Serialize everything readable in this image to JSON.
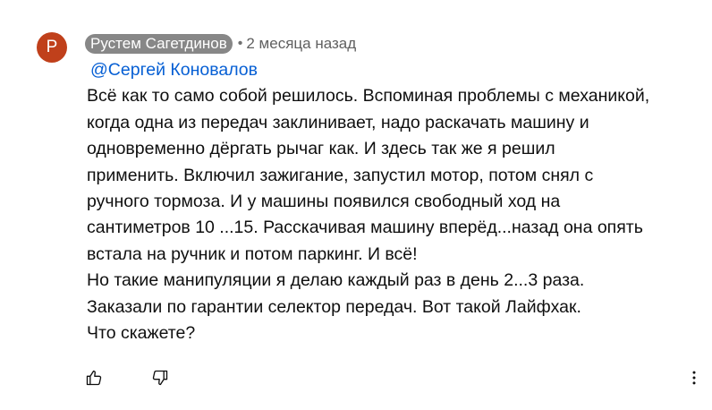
{
  "comment": {
    "avatar_letter": "Р",
    "avatar_color": "#c0401b",
    "author": "Рустем Сагетдинов",
    "separator": "•",
    "time": "2 месяца назад",
    "mention": "@Сергей Коновалов",
    "lines": [
      "Всё как то само собой решилось. Вспоминая проблемы с механикой,",
      "когда одна из передач заклинивает, надо раскачать машину и",
      "одновременно дёргать рычаг как. И здесь так же я решил",
      "применить. Включил зажигание, запустил мотор, потом снял с",
      "ручного тормоза. И у машины появился свободный ход на",
      "сантиметров 10 ...15. Расскачивая машину вперёд...назад она опять",
      "встала на ручник и потом паркинг. И всё!",
      "Но такие манипуляции я делаю каждый раз в день 2...3 раза.",
      "Заказали по гарантии селектор передач. Вот такой Лайфхак.",
      "Что скажете?"
    ]
  },
  "actions": {
    "like_icon": "thumbs-up-icon",
    "dislike_icon": "thumbs-down-icon",
    "more_icon": "more-vertical-icon"
  }
}
